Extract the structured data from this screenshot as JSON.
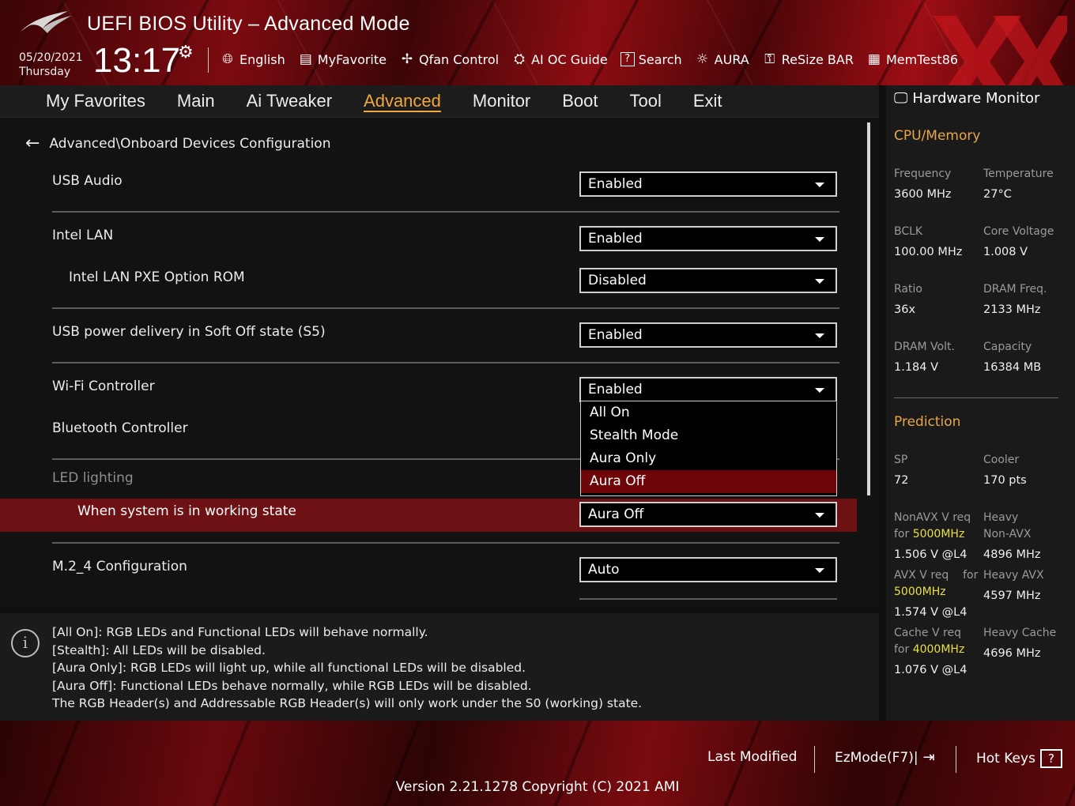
{
  "header": {
    "title": "UEFI BIOS Utility – Advanced Mode",
    "date": "05/20/2021",
    "day": "Thursday",
    "time": "13:17",
    "toolbar": [
      {
        "label": "English",
        "icon": "globe-icon"
      },
      {
        "label": "MyFavorite",
        "icon": "favorite-list-icon"
      },
      {
        "label": "Qfan Control",
        "icon": "fan-icon"
      },
      {
        "label": "AI OC Guide",
        "icon": "ai-chip-icon"
      },
      {
        "label": "Search",
        "icon": "search-icon"
      },
      {
        "label": "AURA",
        "icon": "aura-light-icon"
      },
      {
        "label": "ReSize BAR",
        "icon": "resize-bar-icon"
      },
      {
        "label": "MemTest86",
        "icon": "memory-icon"
      }
    ]
  },
  "nav": {
    "tabs": [
      "My Favorites",
      "Main",
      "Ai Tweaker",
      "Advanced",
      "Monitor",
      "Boot",
      "Tool",
      "Exit"
    ],
    "active": "Advanced"
  },
  "main": {
    "breadcrumb": "Advanced\\Onboard Devices Configuration",
    "settings": [
      {
        "label": "USB Audio",
        "value": "Enabled"
      },
      {
        "label": "Intel LAN",
        "value": "Enabled"
      },
      {
        "label": "Intel LAN PXE Option ROM",
        "value": "Disabled"
      },
      {
        "label": "USB power delivery in Soft Off state (S5)",
        "value": "Enabled"
      },
      {
        "label": "Wi-Fi Controller",
        "value": "Enabled"
      },
      {
        "label": "Bluetooth Controller",
        "value": ""
      },
      {
        "label": "LED lighting",
        "value": ""
      },
      {
        "label": "When system is in working state",
        "value": "Aura Off"
      },
      {
        "label": "M.2_4 Configuration",
        "value": "Auto"
      }
    ],
    "dropdown": {
      "options": [
        "All On",
        "Stealth Mode",
        "Aura Only",
        "Aura Off"
      ],
      "selected": "Aura Off"
    }
  },
  "help": {
    "lines": [
      "[All On]: RGB LEDs and Functional LEDs will behave normally.",
      "[Stealth]: All LEDs will be disabled.",
      "[Aura Only]: RGB LEDs will light up, while all functional LEDs will be disabled.",
      "[Aura Off]: Functional LEDs behave normally, while RGB LEDs will be disabled.",
      "The RGB Header(s) and Addressable RGB Header(s) will only work under the S0 (working) state."
    ]
  },
  "hardware_monitor": {
    "title": "Hardware Monitor",
    "cpu_memory": {
      "heading": "CPU/Memory",
      "items": [
        {
          "label": "Frequency",
          "value": "3600 MHz"
        },
        {
          "label": "Temperature",
          "value": "27°C"
        },
        {
          "label": "BCLK",
          "value": "100.00 MHz"
        },
        {
          "label": "Core Voltage",
          "value": "1.008 V"
        },
        {
          "label": "Ratio",
          "value": "36x"
        },
        {
          "label": "DRAM Freq.",
          "value": "2133 MHz"
        },
        {
          "label": "DRAM Volt.",
          "value": "1.184 V"
        },
        {
          "label": "Capacity",
          "value": "16384 MB"
        }
      ]
    },
    "prediction": {
      "heading": "Prediction",
      "sp_label": "SP",
      "sp_value": "72",
      "cooler_label": "Cooler",
      "cooler_value": "170 pts",
      "nonavx_label_1": "NonAVX V req",
      "nonavx_label_2": "for",
      "nonavx_freq": "5000MHz",
      "nonavx_value": "1.506 V @L4",
      "heavy_nonavx_label_1": "Heavy",
      "heavy_nonavx_label_2": "Non-AVX",
      "heavy_nonavx_value": "4896 MHz",
      "avx_label_1": "AVX V req",
      "avx_label_2": "for",
      "avx_freq": "5000MHz",
      "avx_value": "1.574 V @L4",
      "heavy_avx_label": "Heavy AVX",
      "heavy_avx_value": "4597 MHz",
      "cache_label_1": "Cache V req",
      "cache_label_2": "for",
      "cache_freq": "4000MHz",
      "cache_value": "1.076 V @L4",
      "heavy_cache_label": "Heavy Cache",
      "heavy_cache_value": "4696 MHz"
    }
  },
  "footer": {
    "last_modified": "Last Modified",
    "ezmode": "EzMode(F7)|",
    "hotkeys": "Hot Keys",
    "hotkeys_key": "?",
    "version": "Version 2.21.1278 Copyright (C) 2021 AMI"
  },
  "colors": {
    "accent_orange": "#f1a83b",
    "highlight_red": "#6e1114",
    "prediction_yellow": "#e8e047"
  }
}
